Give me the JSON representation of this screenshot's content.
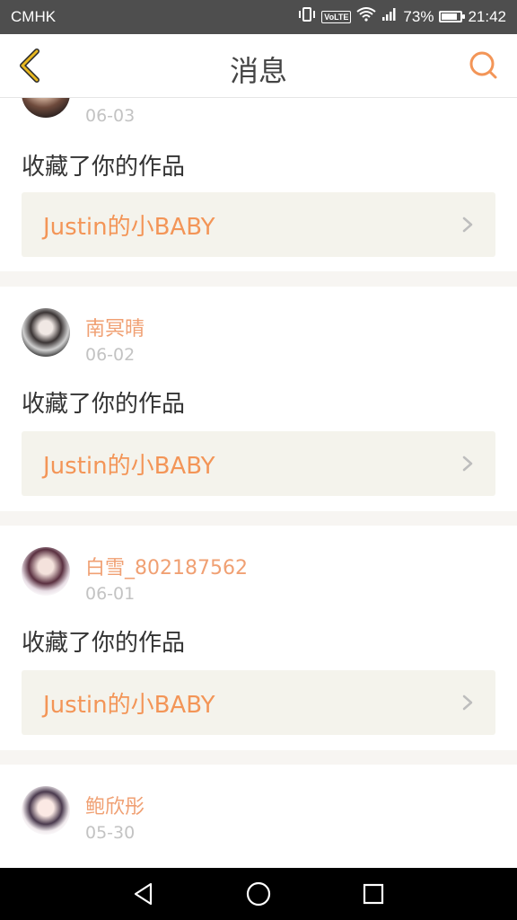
{
  "status_bar": {
    "carrier": "CMHK",
    "volte": "VoLTE",
    "battery": "73%",
    "time": "21:42"
  },
  "header": {
    "title": "消息"
  },
  "messages": [
    {
      "date": "06-03",
      "action": "收藏了你的作品",
      "work_title": "Justin的小BABY"
    },
    {
      "username": "南冥晴",
      "date": "06-02",
      "action": "收藏了你的作品",
      "work_title": "Justin的小BABY"
    },
    {
      "username": "白雪_802187562",
      "date": "06-01",
      "action": "收藏了你的作品",
      "work_title": "Justin的小BABY"
    },
    {
      "username": "鲍欣彤",
      "date": "05-30"
    }
  ],
  "colors": {
    "accent": "#f39557",
    "username": "#f0a073",
    "back": "#e8b820",
    "card_link_bg": "#f4f3ec"
  },
  "icons": [
    "back-arrow-icon",
    "search-icon",
    "chevron-right-icon",
    "nav-back-icon",
    "nav-home-icon",
    "nav-recents-icon"
  ]
}
